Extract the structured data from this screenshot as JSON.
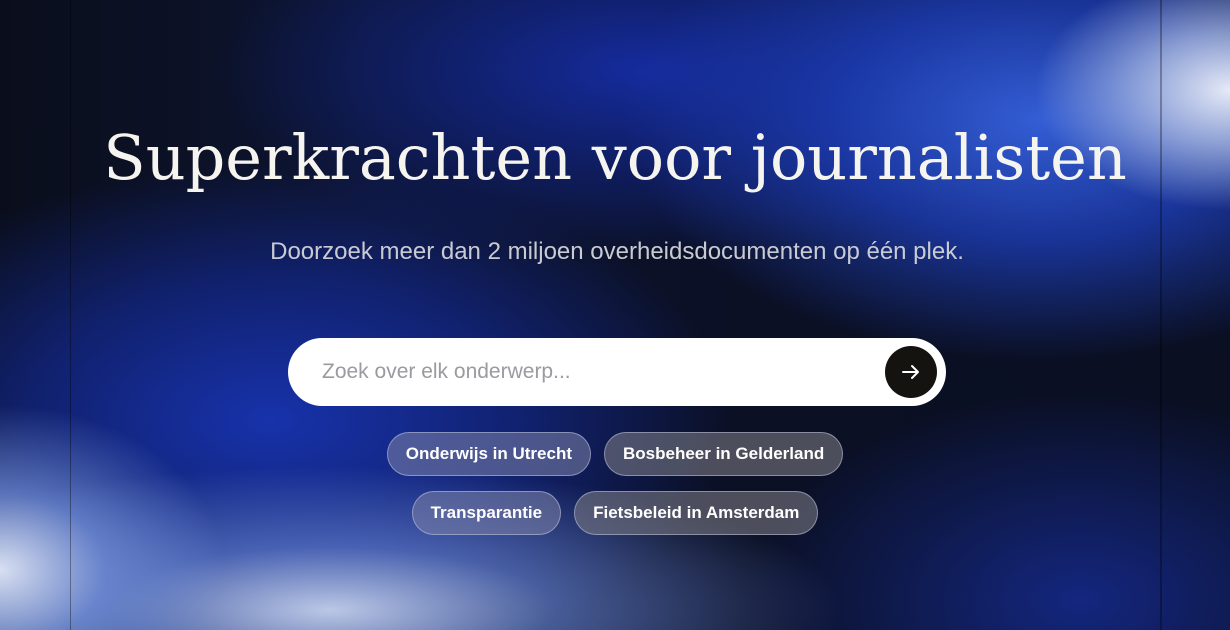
{
  "hero": {
    "title": "Superkrachten voor journalisten",
    "subtitle": "Doorzoek meer dan 2 miljoen overheidsdocumenten op één plek."
  },
  "search": {
    "placeholder": "Zoek over elk onderwerp...",
    "value": "",
    "submit_icon": "arrow-right-icon"
  },
  "suggestions": {
    "row1": [
      "Onderwijs in Utrecht",
      "Bosbeheer in Gelderland"
    ],
    "row2": [
      "Transparantie",
      "Fietsbeleid in Amsterdam"
    ]
  },
  "colors": {
    "title": "#f6f4ee",
    "subtitle": "#c9cbd3",
    "search_bg": "#ffffff",
    "search_button": "#15130f",
    "accent_blue": "#1f3fb8"
  }
}
